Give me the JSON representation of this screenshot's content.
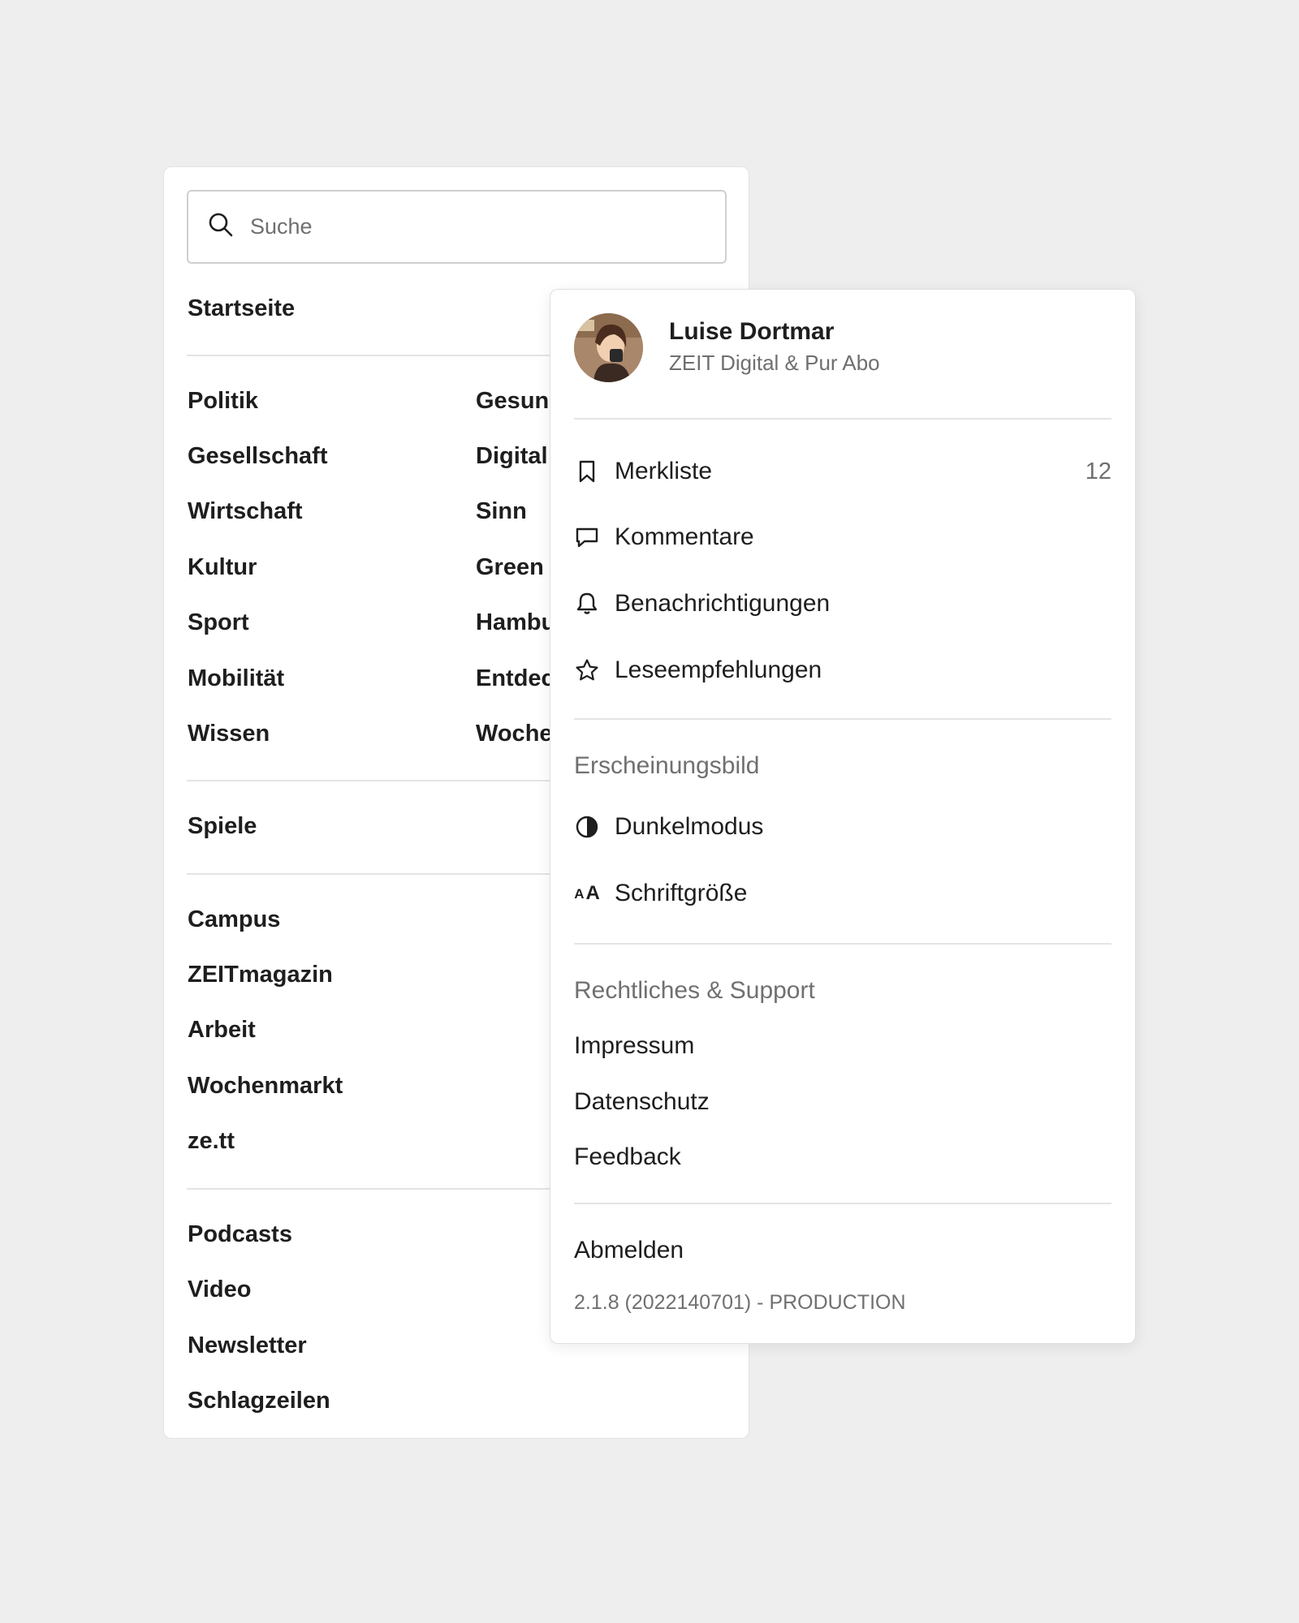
{
  "search": {
    "placeholder": "Suche"
  },
  "nav": {
    "home": "Startseite",
    "col1": [
      "Politik",
      "Gesellschaft",
      "Wirtschaft",
      "Kultur",
      "Sport",
      "Mobilität",
      "Wissen"
    ],
    "col2": [
      "Gesun",
      "Digital",
      "Sinn",
      "Green",
      "Hambu",
      "Entdec",
      "Woche"
    ],
    "games": "Spiele",
    "group3": [
      "Campus",
      "ZEITmagazin",
      "Arbeit",
      "Wochenmarkt",
      "ze.tt"
    ],
    "group4": [
      "Podcasts",
      "Video",
      "Newsletter",
      "Schlagzeilen"
    ]
  },
  "account": {
    "name": "Luise Dortmar",
    "subscription": "ZEIT Digital & Pur Abo",
    "items": [
      {
        "label": "Merkliste",
        "icon": "bookmark-icon",
        "count": "12"
      },
      {
        "label": "Kommentare",
        "icon": "comment-icon"
      },
      {
        "label": "Benachrichtigungen",
        "icon": "bell-icon"
      },
      {
        "label": "Leseempfehlungen",
        "icon": "star-icon"
      }
    ],
    "appearance": {
      "heading": "Erscheinungsbild",
      "dark_mode": "Dunkelmodus",
      "font_size": "Schriftgröße",
      "font_icon_small": "A",
      "font_icon_big": "A"
    },
    "legal": {
      "heading": "Rechtliches & Support",
      "links": [
        "Impressum",
        "Datenschutz",
        "Feedback"
      ]
    },
    "logout": "Abmelden",
    "version": "2.1.8 (2022140701) - PRODUCTION"
  }
}
